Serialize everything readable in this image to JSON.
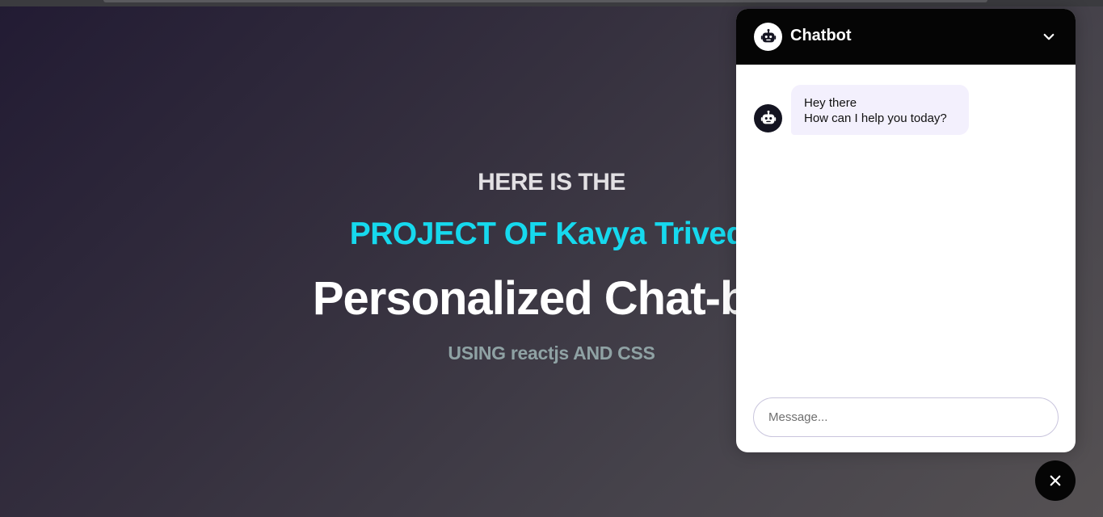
{
  "hero": {
    "kicker": "HERE IS THE",
    "project": "PROJECT OF Kavya Trivedi",
    "title": "Personalized Chat-bot",
    "subtitle": "USING reactjs AND CSS"
  },
  "chatbot": {
    "title": "Chatbot",
    "header_avatar_icon": "robot-icon",
    "collapse_icon": "chevron-down-icon",
    "messages": [
      {
        "sender": "bot",
        "avatar_icon": "robot-icon",
        "lines": [
          "Hey there",
          "How can I help you today?"
        ]
      }
    ],
    "input": {
      "placeholder": "Message...",
      "value": ""
    },
    "toggle_icon": "close-icon"
  },
  "colors": {
    "accent_cyan": "#16d9ee",
    "header_bg": "#050505",
    "bubble_bg": "#f3f0fd",
    "input_border": "#c9c5dd"
  }
}
